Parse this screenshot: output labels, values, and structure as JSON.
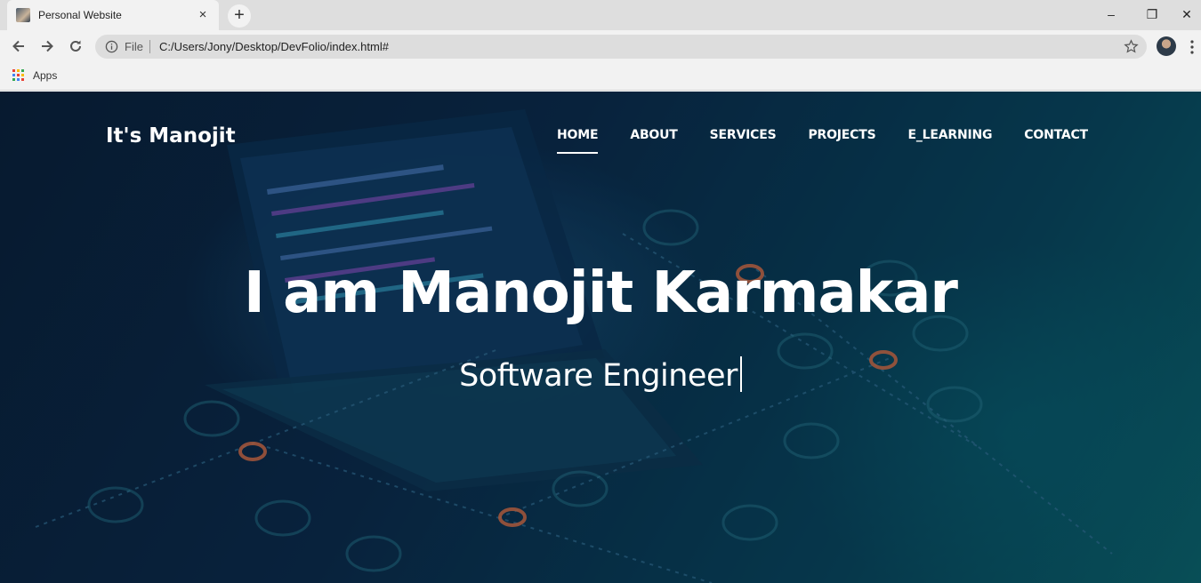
{
  "browser": {
    "tab_title": "Personal Website",
    "tab_close": "×",
    "new_tab": "+",
    "omnibox_scheme": "File",
    "url": "C:/Users/Jony/Desktop/DevFolio/index.html#",
    "bookmarks": {
      "apps_label": "Apps"
    },
    "window_controls": {
      "minimize": "–",
      "restore": "❐",
      "close": "✕"
    }
  },
  "site": {
    "brand": "It's Manojit",
    "nav": [
      {
        "label": "HOME",
        "active": true
      },
      {
        "label": "ABOUT",
        "active": false
      },
      {
        "label": "SERVICES",
        "active": false
      },
      {
        "label": "PROJECTS",
        "active": false
      },
      {
        "label": "E_LEARNING",
        "active": false
      },
      {
        "label": "CONTACT",
        "active": false
      }
    ],
    "hero": {
      "headline": "I am Manojit Karmakar",
      "typed_text": "Software Engineer"
    }
  },
  "colors": {
    "hero_dark": "#0b2a48",
    "hero_teal": "#0b6e70",
    "accent_glow": "#ff6a3a"
  }
}
